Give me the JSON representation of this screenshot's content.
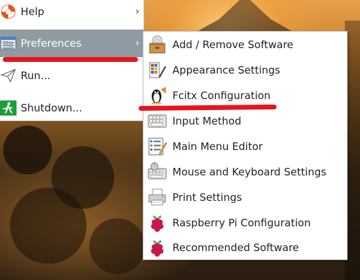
{
  "main_menu": {
    "items": [
      {
        "label": "Help",
        "icon": "lifebuoy-icon",
        "has_submenu": true
      },
      {
        "label": "Preferences",
        "icon": "preferences-icon",
        "has_submenu": true,
        "active": true
      },
      {
        "label": "Run...",
        "icon": "paper-plane-icon",
        "has_submenu": false
      },
      {
        "label": "Shutdown...",
        "icon": "exit-running-man-icon",
        "has_submenu": false
      }
    ],
    "chevron": "›"
  },
  "preferences_submenu": {
    "items": [
      {
        "label": "Add / Remove Software",
        "icon": "software-package-icon"
      },
      {
        "label": "Appearance Settings",
        "icon": "color-palette-icon"
      },
      {
        "label": "Fcitx Configuration",
        "icon": "penguin-keyboard-icon"
      },
      {
        "label": "Input Method",
        "icon": "keyboard-icon"
      },
      {
        "label": "Main Menu Editor",
        "icon": "menu-editor-icon"
      },
      {
        "label": "Mouse and Keyboard Settings",
        "icon": "mouse-keyboard-icon"
      },
      {
        "label": "Print Settings",
        "icon": "printer-icon"
      },
      {
        "label": "Raspberry Pi Configuration",
        "icon": "raspberry-icon"
      },
      {
        "label": "Recommended Software",
        "icon": "raspberry-icon"
      }
    ]
  },
  "colors": {
    "active_highlight": "#8f9ba3",
    "annotation_red": "#e8141c",
    "menu_bg": "#ffffff",
    "text": "#222222"
  }
}
